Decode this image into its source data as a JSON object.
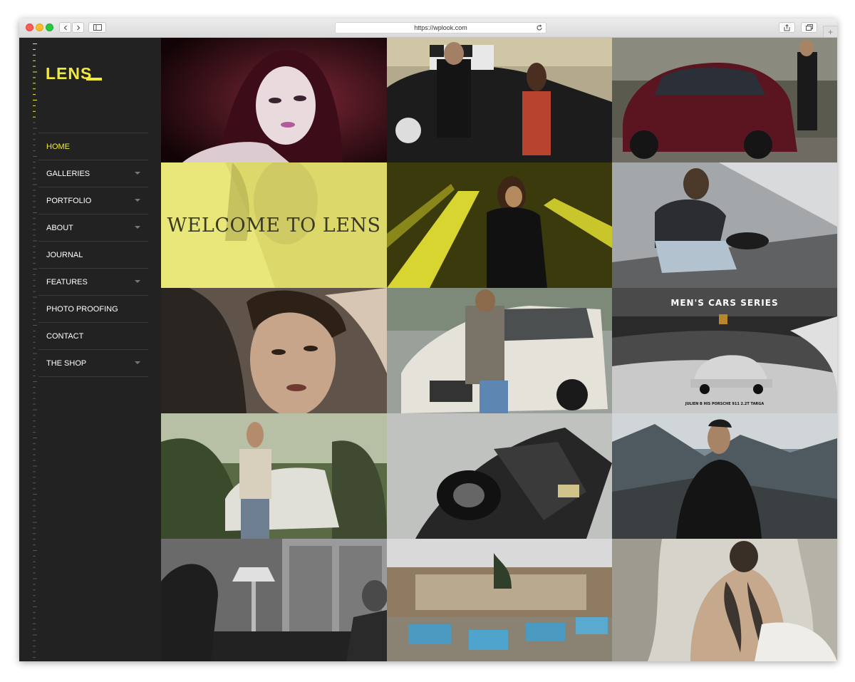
{
  "browser": {
    "url": "https://wplook.com"
  },
  "sidebar": {
    "logo": "LENS",
    "nav": [
      {
        "label": "HOME",
        "active": true,
        "has_submenu": false
      },
      {
        "label": "GALLERIES",
        "active": false,
        "has_submenu": true
      },
      {
        "label": "PORTFOLIO",
        "active": false,
        "has_submenu": true
      },
      {
        "label": "ABOUT",
        "active": false,
        "has_submenu": true
      },
      {
        "label": "JOURNAL",
        "active": false,
        "has_submenu": false
      },
      {
        "label": "FEATURES",
        "active": false,
        "has_submenu": true
      },
      {
        "label": "PHOTO PROOFING",
        "active": false,
        "has_submenu": false
      },
      {
        "label": "CONTACT",
        "active": false,
        "has_submenu": false
      },
      {
        "label": "THE SHOP",
        "active": false,
        "has_submenu": true
      }
    ]
  },
  "grid": {
    "welcome_text": "WELCOME TO LENS",
    "promo_title": "MEN'S CARS SERIES",
    "promo_subtitle": "JULIEN B HIS PORSCHE 911 2.2T TARGA"
  },
  "colors": {
    "accent": "#f0ea3e",
    "sidebar_bg": "#222222",
    "nav_text": "#ffffff",
    "divider": "#3a3a3a"
  }
}
